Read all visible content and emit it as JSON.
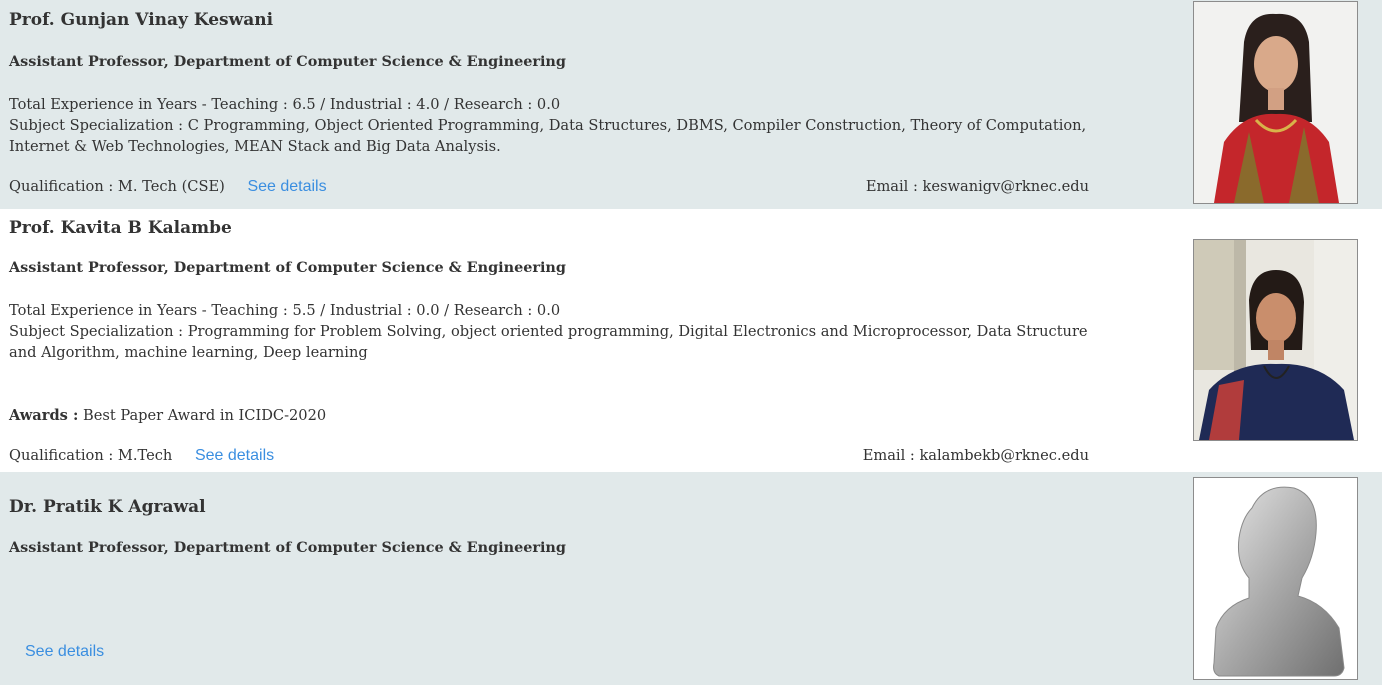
{
  "faculty": [
    {
      "name": "Prof. Gunjan Vinay Keswani",
      "role": "Assistant Professor, Department of Computer Science & Engineering",
      "experience": "Total Experience in Years - Teaching : 6.5 / Industrial : 4.0 / Research : 0.0",
      "specialization": "Subject Specialization : C Programming, Object Oriented Programming, Data Structures, DBMS, Compiler Construction, Theory of Computation, Internet & Web Technologies, MEAN Stack and Big Data Analysis.",
      "qualification": "Qualification : M. Tech (CSE)",
      "see_details": "See details",
      "email": "Email : keswanigv@rknec.edu"
    },
    {
      "name": "Prof. Kavita B Kalambe",
      "role": "Assistant Professor, Department of Computer Science & Engineering",
      "experience": "Total Experience in Years - Teaching : 5.5 / Industrial : 0.0 / Research : 0.0",
      "specialization": "Subject Specialization : Programming for Problem Solving, object oriented programming, Digital Electronics and Microprocessor, Data Structure and Algorithm, machine learning, Deep learning",
      "awards_label": "Awards :",
      "awards": "Best Paper Award in ICIDC-2020",
      "qualification": "Qualification : M.Tech",
      "see_details": "See details",
      "email": "Email : kalambekb@rknec.edu"
    },
    {
      "name": "Dr. Pratik K Agrawal",
      "role": "Assistant Professor, Department of Computer Science & Engineering",
      "see_details": "See details"
    }
  ],
  "icons": {
    "photo1": "faculty-photo",
    "photo2": "faculty-photo",
    "photo3": "default-avatar-icon"
  }
}
